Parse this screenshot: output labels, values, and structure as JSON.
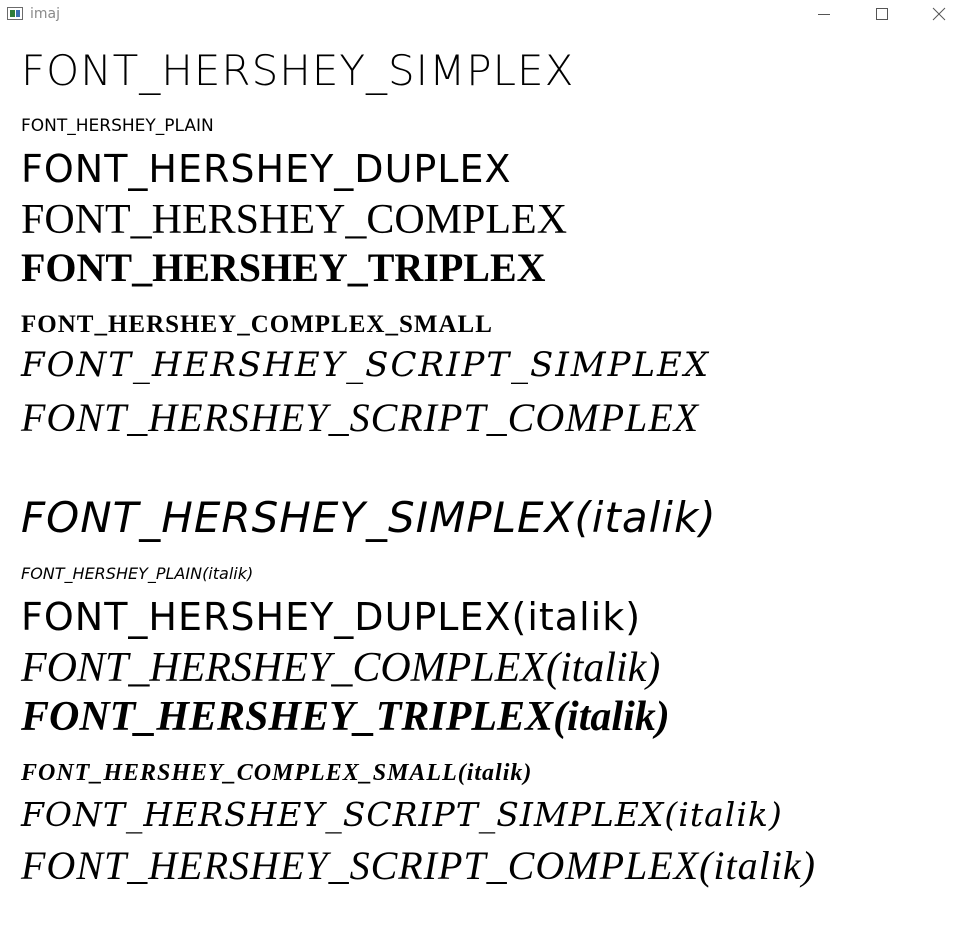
{
  "window": {
    "title": "imaj",
    "controls": {
      "minimize_icon": "minimize-icon",
      "maximize_icon": "maximize-icon",
      "close_icon": "close-icon"
    }
  },
  "samples": {
    "regular": [
      "FONT_HERSHEY_SIMPLEX",
      "FONT_HERSHEY_PLAIN",
      "FONT_HERSHEY_DUPLEX",
      "FONT_HERSHEY_COMPLEX",
      "FONT_HERSHEY_TRIPLEX",
      "FONT_HERSHEY_COMPLEX_SMALL",
      "FONT_HERSHEY_SCRIPT_SIMPLEX",
      "FONT_HERSHEY_SCRIPT_COMPLEX"
    ],
    "italic": [
      "FONT_HERSHEY_SIMPLEX(italik)",
      "FONT_HERSHEY_PLAIN(italik)",
      "FONT_HERSHEY_DUPLEX(italik)",
      "FONT_HERSHEY_COMPLEX(italik)",
      "FONT_HERSHEY_TRIPLEX(italik)",
      "FONT_HERSHEY_COMPLEX_SMALL(italik)",
      "FONT_HERSHEY_SCRIPT_SIMPLEX(italik)",
      "FONT_HERSHEY_SCRIPT_COMPLEX(italik)"
    ]
  },
  "colors": {
    "text": "#000000",
    "background": "#ffffff",
    "title_text": "#8a8a8a"
  }
}
